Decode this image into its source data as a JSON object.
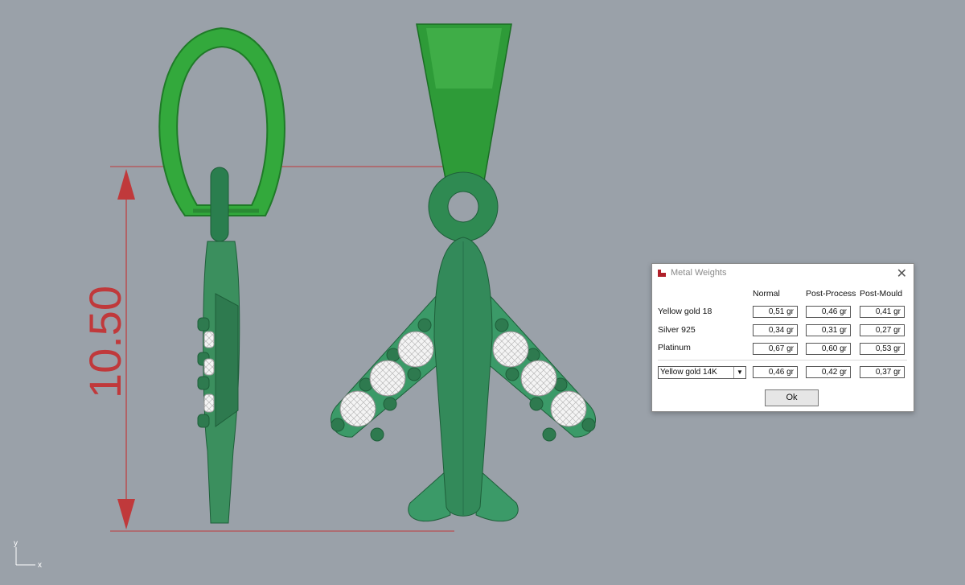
{
  "viewport": {
    "dimension_value": "10.50",
    "axis_y": "y",
    "axis_x": "x",
    "colors": {
      "background": "#9aa1a9",
      "metal": "#2f8a52",
      "bail": "#2fa33a",
      "dimension": "#c0393b"
    }
  },
  "dialog": {
    "title": "Metal Weights",
    "columns": [
      "Normal",
      "Post-Process",
      "Post-Mould"
    ],
    "rows": [
      {
        "label": "Yellow gold 18",
        "values": [
          "0,51 gr",
          "0,46 gr",
          "0,41 gr"
        ]
      },
      {
        "label": "Silver 925",
        "values": [
          "0,34 gr",
          "0,31 gr",
          "0,27 gr"
        ]
      },
      {
        "label": "Platinum",
        "values": [
          "0,67 gr",
          "0,60 gr",
          "0,53 gr"
        ]
      }
    ],
    "custom": {
      "selected": "Yellow gold 14K",
      "values": [
        "0,46 gr",
        "0,42 gr",
        "0,37 gr"
      ]
    },
    "ok_label": "Ok"
  }
}
